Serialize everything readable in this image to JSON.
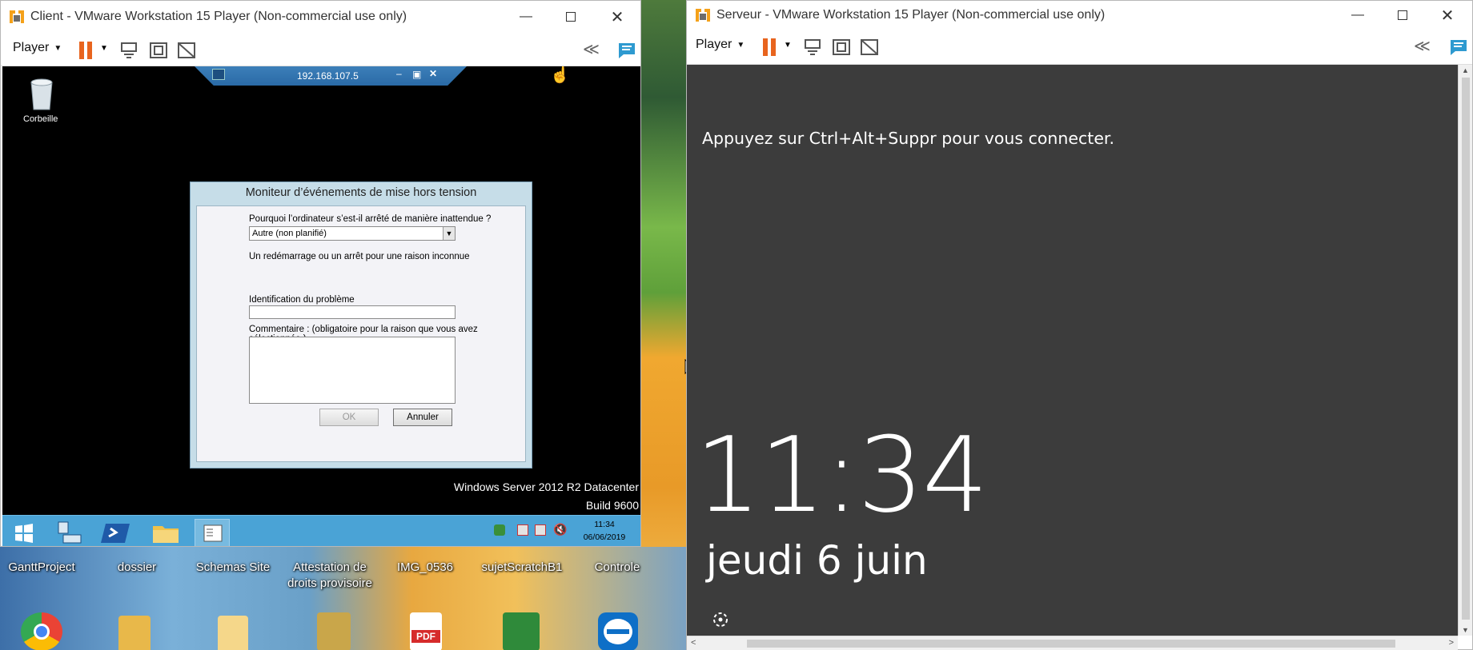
{
  "host": {
    "desktop_icons": [
      {
        "label": "GanttProject"
      },
      {
        "label": "dossier"
      },
      {
        "label": "Schemas Site"
      },
      {
        "label": "Attestation de droits provisoire"
      },
      {
        "label": "IMG_0536"
      },
      {
        "label": "sujetScratchB1"
      },
      {
        "label": "Controle"
      }
    ],
    "bottom_icons": [
      "chrome-icon",
      "folder-icon",
      "file-icon",
      "archive-icon",
      "pdf-icon",
      "tools-icon",
      "teamviewer-icon"
    ],
    "pdf_label": "PDF"
  },
  "client": {
    "title": "Client - VMware Workstation 15 Player (Non-commercial use only)",
    "player_label": "Player",
    "rdp_ip": "192.168.107.5",
    "recycle_label": "Corbeille",
    "dialog": {
      "title": "Moniteur d’événements de mise hors tension",
      "question": "Pourquoi l’ordinateur s’est-il arrêté de manière inattendue ?",
      "select_value": "Autre (non planifié)",
      "reason_desc": "Un redémarrage ou un arrêt pour une raison inconnue",
      "problem_label": "Identification du problème",
      "problem_value": "",
      "comment_label": "Commentaire : (obligatoire pour la raison que vous avez sélectionnée.)",
      "comment_value": "",
      "ok_label": "OK",
      "cancel_label": "Annuler"
    },
    "watermark_line1": "Windows Server 2012 R2 Datacenter",
    "watermark_line2": "Build 9600",
    "clock_time": "11:34",
    "clock_date": "06/06/2019"
  },
  "server": {
    "title": "Serveur - VMware Workstation 15 Player (Non-commercial use only)",
    "player_label": "Player",
    "lock_message": "Appuyez sur Ctrl+Alt+Suppr pour vous connecter.",
    "time": "11:34",
    "date": "jeudi 6 juin"
  },
  "colors": {
    "accent_orange": "#e8641e",
    "taskbar_blue": "#4aa3d6",
    "server_bg": "#3c3c3c"
  }
}
